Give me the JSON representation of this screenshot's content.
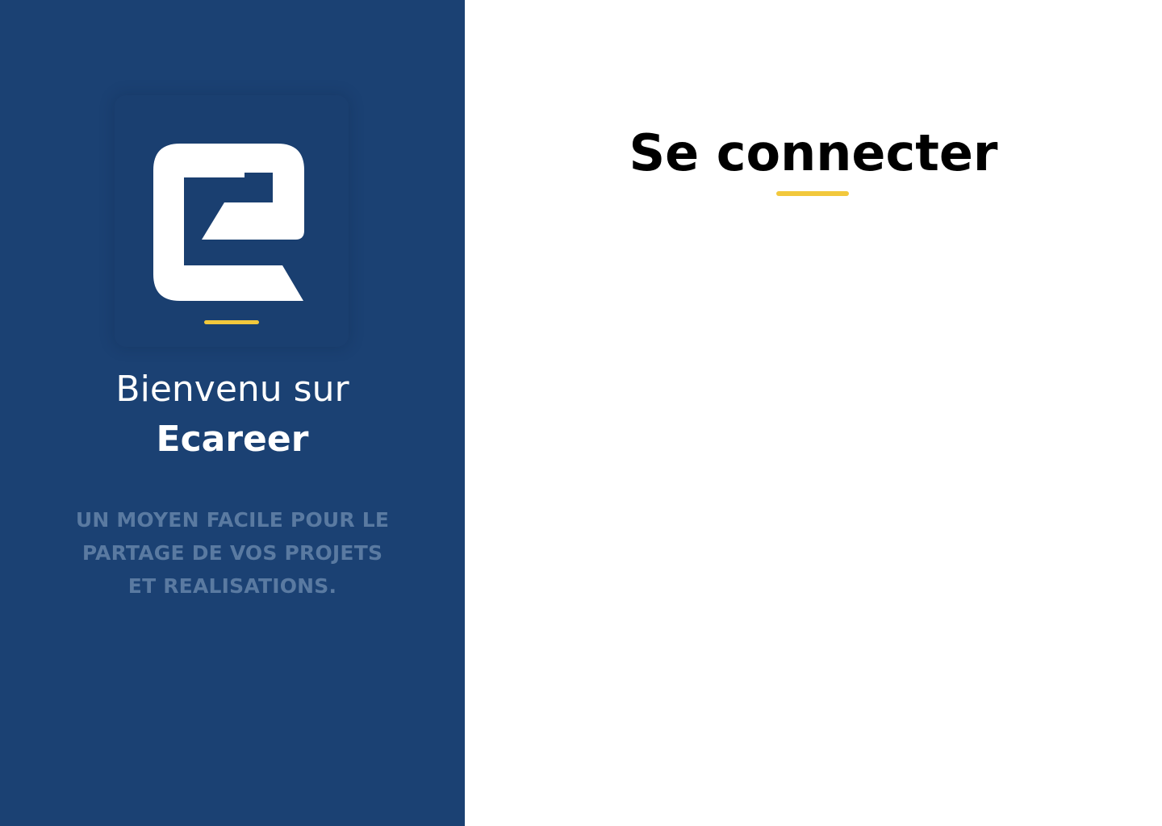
{
  "brand": {
    "logo_icon": "ecareer-logo-icon",
    "welcome_line1": "Bienvenu sur",
    "welcome_line2": "Ecareer",
    "tagline_lines": [
      "UN MOYEN FACILE POUR LE",
      "PARTAGE DE VOS PROJETS",
      "ET REALISATIONS."
    ]
  },
  "login": {
    "title": "Se connecter"
  },
  "colors": {
    "panel_blue": "#1b4173",
    "accent_yellow": "#f2c83c",
    "tagline_gray_blue": "#5a7aa1",
    "title_black": "#000000"
  }
}
